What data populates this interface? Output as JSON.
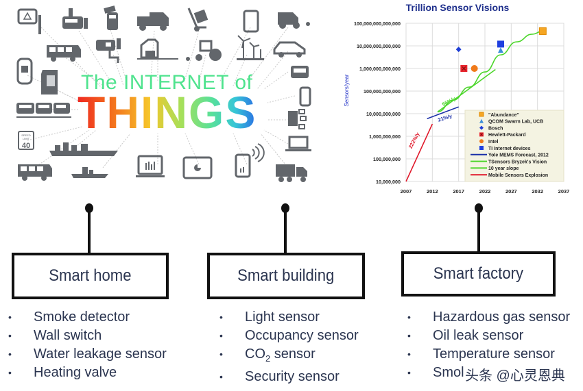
{
  "iot_graphic": {
    "title_line1": "The INTERNET of",
    "title_line2": "THINGS",
    "icons": [
      "warning-sign-icon",
      "factory-meter-icon",
      "payment-terminal-icon",
      "delivery-truck-icon",
      "hand-truck-icon",
      "tablet-icon",
      "harvester-icon",
      "bus-icon",
      "security-camera-icon",
      "house-icon",
      "tractor-icon",
      "wind-turbine-icon",
      "car-icon",
      "parking-meter-icon",
      "sim-card-icon",
      "monitor-device-icon",
      "train-icon",
      "smartphone-icon",
      "speed-limit-sign-icon",
      "cargo-ship-icon",
      "building-network-icon",
      "bus-icon",
      "small-ship-icon",
      "laptop-chart-icon",
      "tablet-pie-icon",
      "phone-signal-icon",
      "laptop-icon",
      "truck-icon"
    ],
    "speed_sign_text": [
      "SPEED",
      "LIMIT",
      "40"
    ]
  },
  "chart_data": {
    "type": "scatter",
    "title": "Trillion Sensor Visions",
    "xlabel": "",
    "ylabel": "Sensors/year",
    "y_scale": "log",
    "xlim": [
      2007,
      2037
    ],
    "ylim": [
      10000000,
      100000000000000
    ],
    "x_ticks": [
      "2007",
      "2012",
      "2017",
      "2022",
      "2027",
      "2032",
      "2037"
    ],
    "y_ticks": [
      "10,000,000",
      "100,000,000",
      "1,000,000,000",
      "10,000,000,000",
      "100,000,000,000",
      "1,000,000,000,000",
      "10,000,000,000,000",
      "100,000,000,000,000"
    ],
    "grid": true,
    "legend_position": "bottom-right",
    "points": [
      {
        "name": "\"Abundance\"",
        "marker": "square",
        "color": "#f5a623",
        "x": 2033,
        "y": 45000000000000
      },
      {
        "name": "QCOM Swarm Lab, UCB",
        "marker": "triangle",
        "color": "#3c8fd8",
        "x": 2025,
        "y": 6500000000000
      },
      {
        "name": "Bosch",
        "marker": "diamond",
        "color": "#1f3fd6",
        "x": 2017,
        "y": 7000000000000
      },
      {
        "name": "Hewlett-Packard",
        "marker": "square-x",
        "color": "#e8262e",
        "x": 2018,
        "y": 1000000000000
      },
      {
        "name": "Intel",
        "marker": "circle",
        "color": "#f07a1a",
        "x": 2020,
        "y": 1000000000000
      },
      {
        "name": "TI Internet devices",
        "marker": "square",
        "color": "#1f3fe0",
        "x": 2025,
        "y": 12000000000000
      }
    ],
    "series": [
      {
        "name": "Yole MEMS Forecast, 2012",
        "color": "#1a2fa8",
        "x": [
          2011,
          2017
        ],
        "y": [
          6000000000,
          20000000000
        ]
      },
      {
        "name": "TSensors Bryzek's Vision",
        "color": "#4cd62b",
        "x": [
          2013,
          2016,
          2019,
          2022,
          2025,
          2028,
          2031,
          2033
        ],
        "y": [
          12000000000,
          40000000000,
          150000000000,
          700000000000,
          4000000000000,
          15000000000000,
          33000000000000,
          45000000000000
        ]
      },
      {
        "name": "10 year slope",
        "color": "#4cd62b",
        "x": [
          2013,
          2024
        ],
        "y": [
          12000000000,
          900000000000
        ]
      },
      {
        "name": "Mobile Sensors Explosion",
        "color": "#e0182a",
        "x": [
          2007,
          2012
        ],
        "y": [
          10000000,
          3500000000
        ]
      }
    ],
    "annotations": [
      {
        "text": "56%/y",
        "color": "#4cd62b",
        "x": 2015.3,
        "y": 30000000000
      },
      {
        "text": "21%/y",
        "color": "#1a2fa8",
        "x": 2014.5,
        "y": 5500000000
      },
      {
        "text": "222%/y",
        "color": "#e0182a",
        "x": 2008.8,
        "y": 600000000
      }
    ],
    "legend": [
      {
        "label": "\"Abundance\"",
        "kind": "marker",
        "marker": "square",
        "color": "#f5a623"
      },
      {
        "label": "QCOM Swarm Lab, UCB",
        "kind": "marker",
        "marker": "triangle",
        "color": "#3c8fd8"
      },
      {
        "label": "Bosch",
        "kind": "marker",
        "marker": "diamond",
        "color": "#1f3fd6"
      },
      {
        "label": "Hewlett-Packard",
        "kind": "marker",
        "marker": "square-x",
        "color": "#e8262e"
      },
      {
        "label": "Intel",
        "kind": "marker",
        "marker": "circle",
        "color": "#f07a1a"
      },
      {
        "label": "TI Internet devices",
        "kind": "marker",
        "marker": "square",
        "color": "#1f3fe0"
      },
      {
        "label": "Yole MEMS Forecast, 2012",
        "kind": "line",
        "color": "#1a2fa8"
      },
      {
        "label": "TSensors Bryzek's Vision",
        "kind": "line",
        "color": "#4cd62b"
      },
      {
        "label": "10 year slope",
        "kind": "line",
        "color": "#4cd62b"
      },
      {
        "label": "Mobile Sensors Explosion",
        "kind": "line",
        "color": "#e0182a"
      }
    ]
  },
  "categories": [
    {
      "label": "Smart home",
      "items": [
        "Smoke detector",
        "Wall switch",
        "Water leakage sensor",
        "Heating valve"
      ]
    },
    {
      "label": "Smart building",
      "items": [
        "Light sensor",
        "Occupancy sensor",
        "CO",
        "Security sensor"
      ],
      "co2_subscript": "2",
      "co2_suffix": " sensor"
    },
    {
      "label": "Smart factory",
      "items": [
        "Hazardous gas sensor",
        "Oil leak sensor",
        "Temperature sensor",
        "Smol"
      ]
    }
  ],
  "bullet": "•",
  "watermark": "头条 @心灵恩典"
}
